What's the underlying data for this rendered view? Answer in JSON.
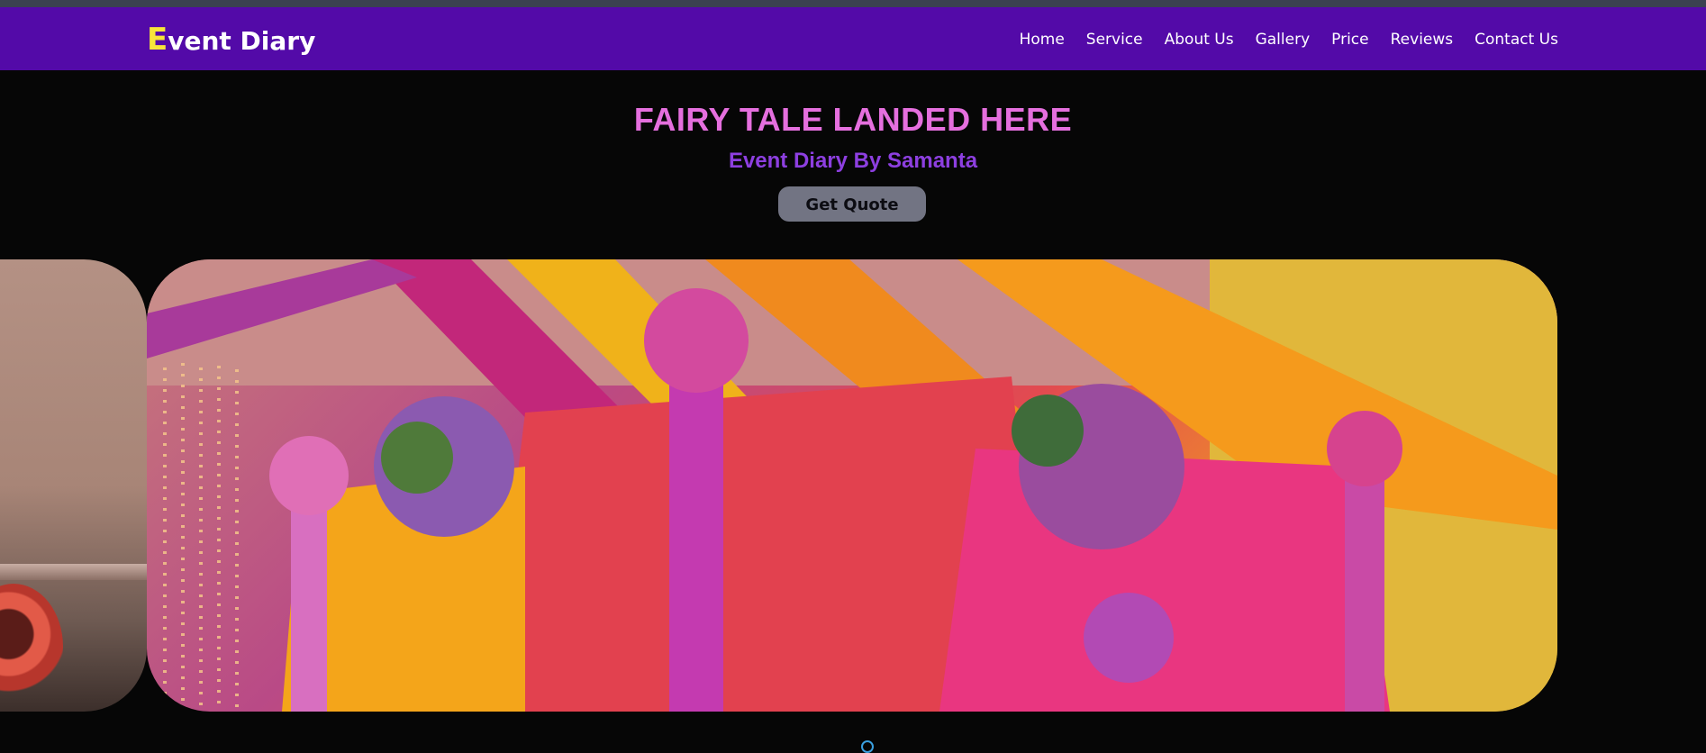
{
  "brand": {
    "first_letter": "E",
    "rest": "vent Diary"
  },
  "nav": {
    "items": [
      "Home",
      "Service",
      "About Us",
      "Gallery",
      "Price",
      "Reviews",
      "Contact Us"
    ]
  },
  "hero": {
    "title": "FAIRY TALE LANDED HERE",
    "subtitle": "Event Diary By Samanta",
    "cta_label": "Get Quote"
  },
  "colors": {
    "navbar": "#530aa8",
    "brand_accent": "#f7e63a",
    "title": "#e56fde",
    "subtitle": "#8d3fe0",
    "button": "#727483",
    "background": "#060606"
  }
}
